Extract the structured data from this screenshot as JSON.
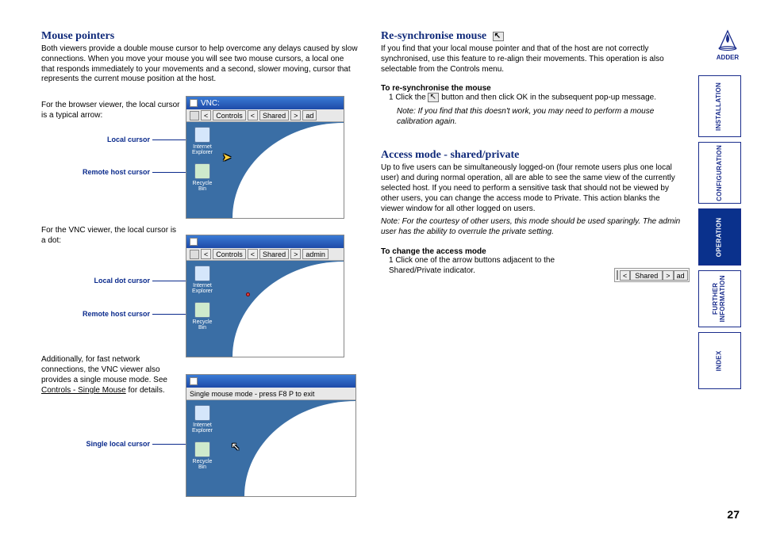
{
  "pageNumber": "27",
  "logo": "ADDER",
  "sidebar": {
    "tabs": [
      "INSTALLATION",
      "CONFIGURATION",
      "OPERATION",
      "FURTHER\nINFORMATION",
      "INDEX"
    ],
    "activeIndex": 2
  },
  "left": {
    "title": "Mouse pointers",
    "intro": "Both viewers provide a double mouse cursor to help overcome any delays caused by slow connections. When you move your mouse you will see two mouse cursors, a local one that responds immediately to your movements and a second, slower moving, cursor that represents the current mouse position at the host.",
    "browserText": "For the browser viewer, the local cursor is a typical arrow:",
    "annot1a": "Local cursor",
    "annot1b": "Remote host cursor",
    "vncText": "For the VNC viewer, the local cursor is a dot:",
    "annot2a": "Local dot cursor",
    "annot2b": "Remote host cursor",
    "singleText_pre": "Additionally, for fast network connections, the VNC viewer also provides a single mouse mode. See ",
    "singleLink": "Controls - Single Mouse",
    "singleText_post": " for details.",
    "annot3": "Single local cursor",
    "thumb": {
      "vncTitle": "VNC:",
      "controlsBtn": "Controls",
      "sharedBtn": "Shared",
      "adminSuffix": "ad",
      "adminSuffix2": "admin",
      "singleMouseBar": "Single mouse mode - press F8 P to exit",
      "iconIE": "Internet Explorer",
      "iconRecycle": "Recycle Bin"
    }
  },
  "right": {
    "resyncTitle": "Re-synchronise mouse",
    "resyncBody": "If you find that your local mouse pointer and that of the host are not correctly synchronised, use this feature to re-align their movements. This operation is also selectable from the Controls menu.",
    "resyncSub": "To re-synchronise the mouse",
    "resyncStep1a": "1  Click the ",
    "resyncStep1b": " button and then click OK in the subsequent pop-up message.",
    "resyncNote": "Note: If you find that this doesn't work, you may need to perform a mouse calibration again.",
    "accessTitle": "Access mode - shared/private",
    "accessBody": "Up to five users can be simultaneously logged-on (four remote users plus one local user) and during normal operation, all are able to see the same view of the currently selected host. If you need to perform a sensitive task that should not be viewed by other users, you can change the access mode to Private. This action blanks the viewer window for all other logged on users.",
    "accessNote": "Note: For the courtesy of other users, this mode should be used sparingly. The admin user has the ability to overrule the private setting.",
    "accessSub": "To change the access mode",
    "accessStep1": "1  Click one of the arrow buttons adjacent to the Shared/Private indicator.",
    "sharedStrip": {
      "label": "Shared",
      "suffix": "ad"
    }
  }
}
